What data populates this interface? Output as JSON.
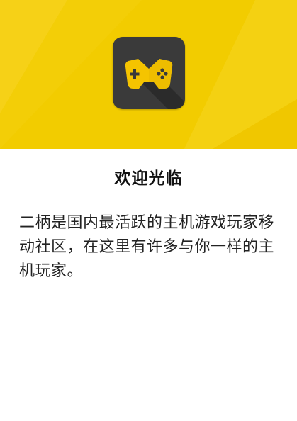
{
  "header": {
    "background_color": "#f2cc00",
    "app_icon": {
      "icon": "gamepad-icon",
      "background_color": "#3a3a3a",
      "accent_color": "#f5c400"
    }
  },
  "welcome": {
    "title": "欢迎光临",
    "description": "二柄是国内最活跃的主机游戏玩家移动社区，在这里有许多与你一样的主机玩家。"
  }
}
